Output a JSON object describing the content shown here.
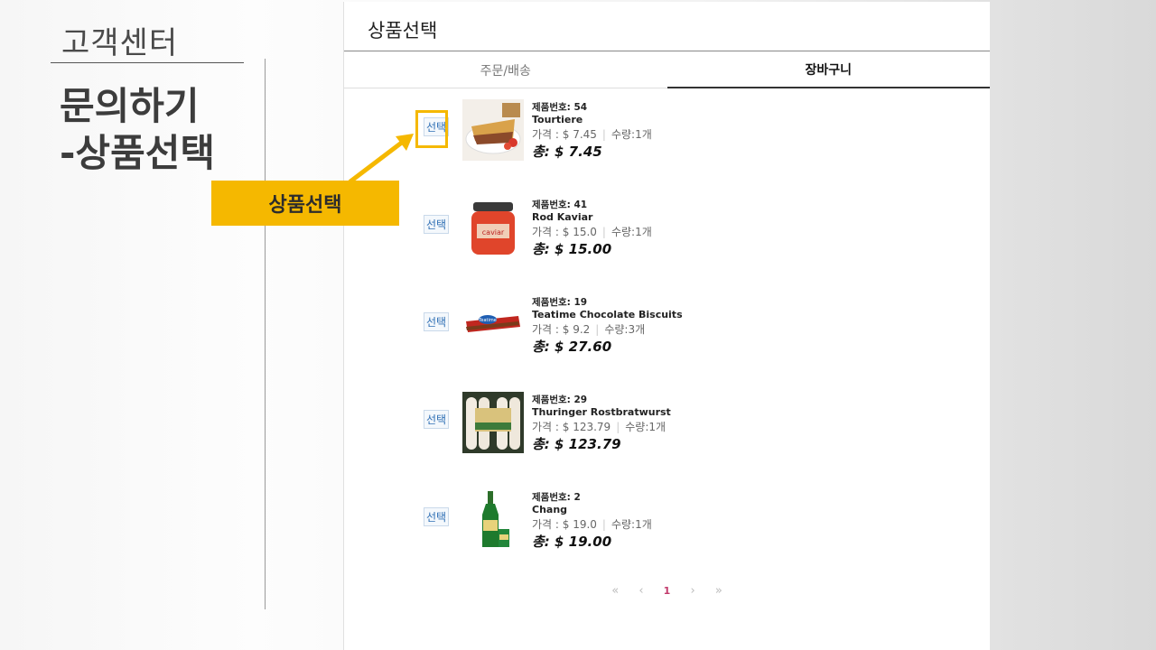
{
  "slide": {
    "section_title": "고객센터",
    "heading_line1": "문의하기",
    "heading_line2": "-상품선택",
    "callout": "상품선택"
  },
  "panel": {
    "title": "상품선택",
    "tabs": [
      {
        "label": "주문/배송",
        "active": false
      },
      {
        "label": "장바구니",
        "active": true
      }
    ]
  },
  "items": [
    {
      "select": "선택",
      "code": "제품번호: 54",
      "name": "Tourtiere",
      "price": "가격 : $ 7.45",
      "qty": "수량:1개",
      "total": "총: $ 7.45"
    },
    {
      "select": "선택",
      "code": "제품번호: 41",
      "name": "Rod Kaviar",
      "price": "가격 : $ 15.0",
      "qty": "수량:1개",
      "total": "총: $ 15.00"
    },
    {
      "select": "선택",
      "code": "제품번호: 19",
      "name": "Teatime Chocolate Biscuits",
      "price": "가격 : $ 9.2",
      "qty": "수량:3개",
      "total": "총: $ 27.60"
    },
    {
      "select": "선택",
      "code": "제품번호: 29",
      "name": "Thuringer Rostbratwurst",
      "price": "가격 : $ 123.79",
      "qty": "수량:1개",
      "total": "총: $ 123.79"
    },
    {
      "select": "선택",
      "code": "제품번호: 2",
      "name": "Chang",
      "price": "가격 : $ 19.0",
      "qty": "수량:1개",
      "total": "총: $ 19.00"
    }
  ],
  "pagination": {
    "first": "«",
    "prev": "‹",
    "current": "1",
    "next": "›",
    "last": "»"
  },
  "colors": {
    "accent": "#f5b800",
    "page_current": "#c23a6b",
    "select_text": "#2f6fb5"
  }
}
